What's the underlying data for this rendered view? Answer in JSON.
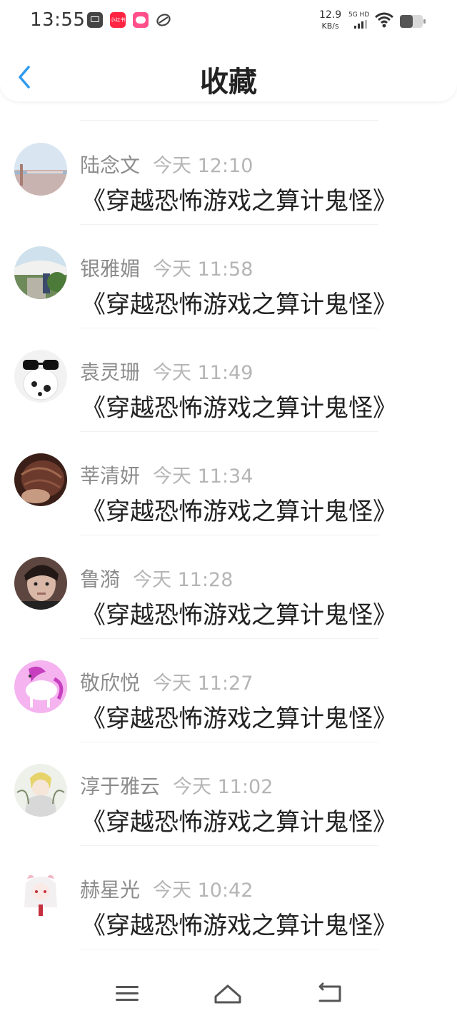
{
  "status_bar": {
    "time": "13:55",
    "xhs_label": "小红书",
    "net_speed": "12.9",
    "net_unit": "KB/s",
    "signal_label": "5G HD"
  },
  "header": {
    "title": "收藏"
  },
  "items": [
    {
      "name": "陆念文",
      "time": "今天 12:10",
      "message": "《穿越恐怖游戏之算计鬼怪》"
    },
    {
      "name": "银雅媚",
      "time": "今天 11:58",
      "message": "《穿越恐怖游戏之算计鬼怪》"
    },
    {
      "name": "袁灵珊",
      "time": "今天 11:49",
      "message": "《穿越恐怖游戏之算计鬼怪》"
    },
    {
      "name": "莘清妍",
      "time": "今天 11:34",
      "message": "《穿越恐怖游戏之算计鬼怪》"
    },
    {
      "name": "鲁漪",
      "time": "今天 11:28",
      "message": "《穿越恐怖游戏之算计鬼怪》"
    },
    {
      "name": "敬欣悦",
      "time": "今天 11:27",
      "message": "《穿越恐怖游戏之算计鬼怪》"
    },
    {
      "name": "淳于雅云",
      "time": "今天 11:02",
      "message": "《穿越恐怖游戏之算计鬼怪》"
    },
    {
      "name": "赫星光",
      "time": "今天 10:42",
      "message": "《穿越恐怖游戏之算计鬼怪》"
    }
  ],
  "colors": {
    "accent": "#2f9bf0",
    "name_text": "#8c8c8c",
    "time_text": "#b5b5b5",
    "message_text": "#222222"
  },
  "icons": {
    "back": "chevron-left-icon",
    "nav_menu": "menu-icon",
    "nav_home": "home-icon",
    "nav_back": "return-icon"
  }
}
